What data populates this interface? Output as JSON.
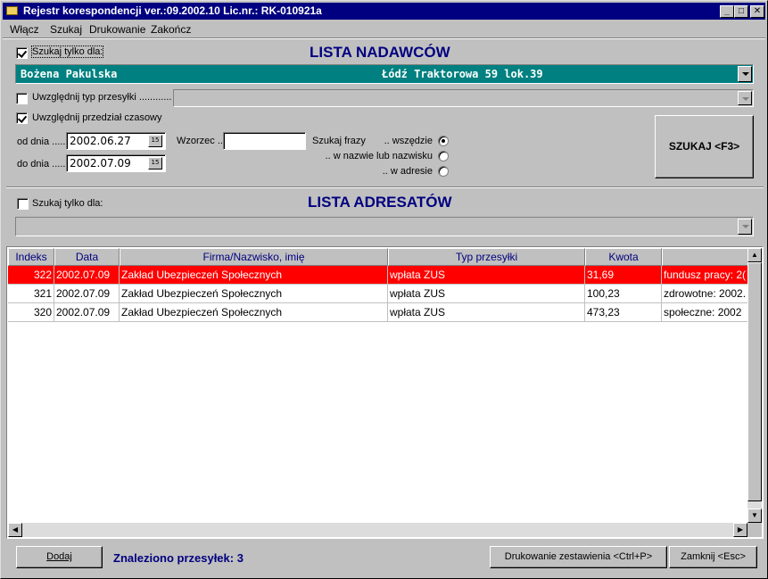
{
  "window": {
    "title": "Rejestr korespondencji ver.:09.2002.10 Lic.nr.: RK-010921a"
  },
  "menu": [
    "Włącz",
    "Szukaj",
    "Drukowanie",
    "Zakończ"
  ],
  "senders": {
    "checkbox_label": "Szukaj tylko dla:",
    "checked": true,
    "title": "LISTA NADAWCÓW",
    "selected_name": "Bożena Pakulska",
    "selected_address": "Łódź Traktorowa 59 lok.39"
  },
  "type_filter": {
    "label": "Uwzględnij typ przesyłki ............",
    "checked": false
  },
  "date_filter": {
    "label": "Uwzględnij przedział czasowy",
    "checked": true,
    "from_label": "od dnia ......",
    "from_value": "2002.06.27",
    "to_label": "do dnia ......",
    "to_value": "2002.07.09",
    "cal_icon": "15"
  },
  "pattern": {
    "label": "Wzorzec ..",
    "value": ""
  },
  "phrase": {
    "label": "Szukaj frazy",
    "options": [
      ".. wszędzie",
      ".. w nazwie lub nazwisku",
      ".. w adresie"
    ],
    "selected": 0
  },
  "search_button": "SZUKAJ <F3>",
  "recipients": {
    "checkbox_label": "Szukaj tylko dla:",
    "checked": false,
    "title": "LISTA ADRESATÓW"
  },
  "table": {
    "columns": [
      "Indeks",
      "Data",
      "Firma/Nazwisko, imię",
      "Typ przesyłki",
      "Kwota",
      ""
    ],
    "rows": [
      {
        "index": "322",
        "date": "2002.07.09",
        "company": "Zakład Ubezpieczeń Społecznych",
        "type": "wpłata ZUS",
        "amount": "31,69",
        "note": "fundusz pracy: 2("
      },
      {
        "index": "321",
        "date": "2002.07.09",
        "company": "Zakład Ubezpieczeń Społecznych",
        "type": "wpłata ZUS",
        "amount": "100,23",
        "note": "zdrowotne: 2002."
      },
      {
        "index": "320",
        "date": "2002.07.09",
        "company": "Zakład Ubezpieczeń Społecznych",
        "type": "wpłata ZUS",
        "amount": "473,23",
        "note": "społeczne: 2002"
      }
    ],
    "selected_row": 0
  },
  "footer": {
    "add_button": "Dodaj",
    "found_text": "Znaleziono przesyłek: 3",
    "print_button": "Drukowanie zestawienia <Ctrl+P>",
    "close_button": "Zamknij <Esc>"
  },
  "colors": {
    "titlebar": "#000080",
    "sender_bar": "#008080",
    "selected_row": "#ff0000",
    "heading": "#000080"
  }
}
